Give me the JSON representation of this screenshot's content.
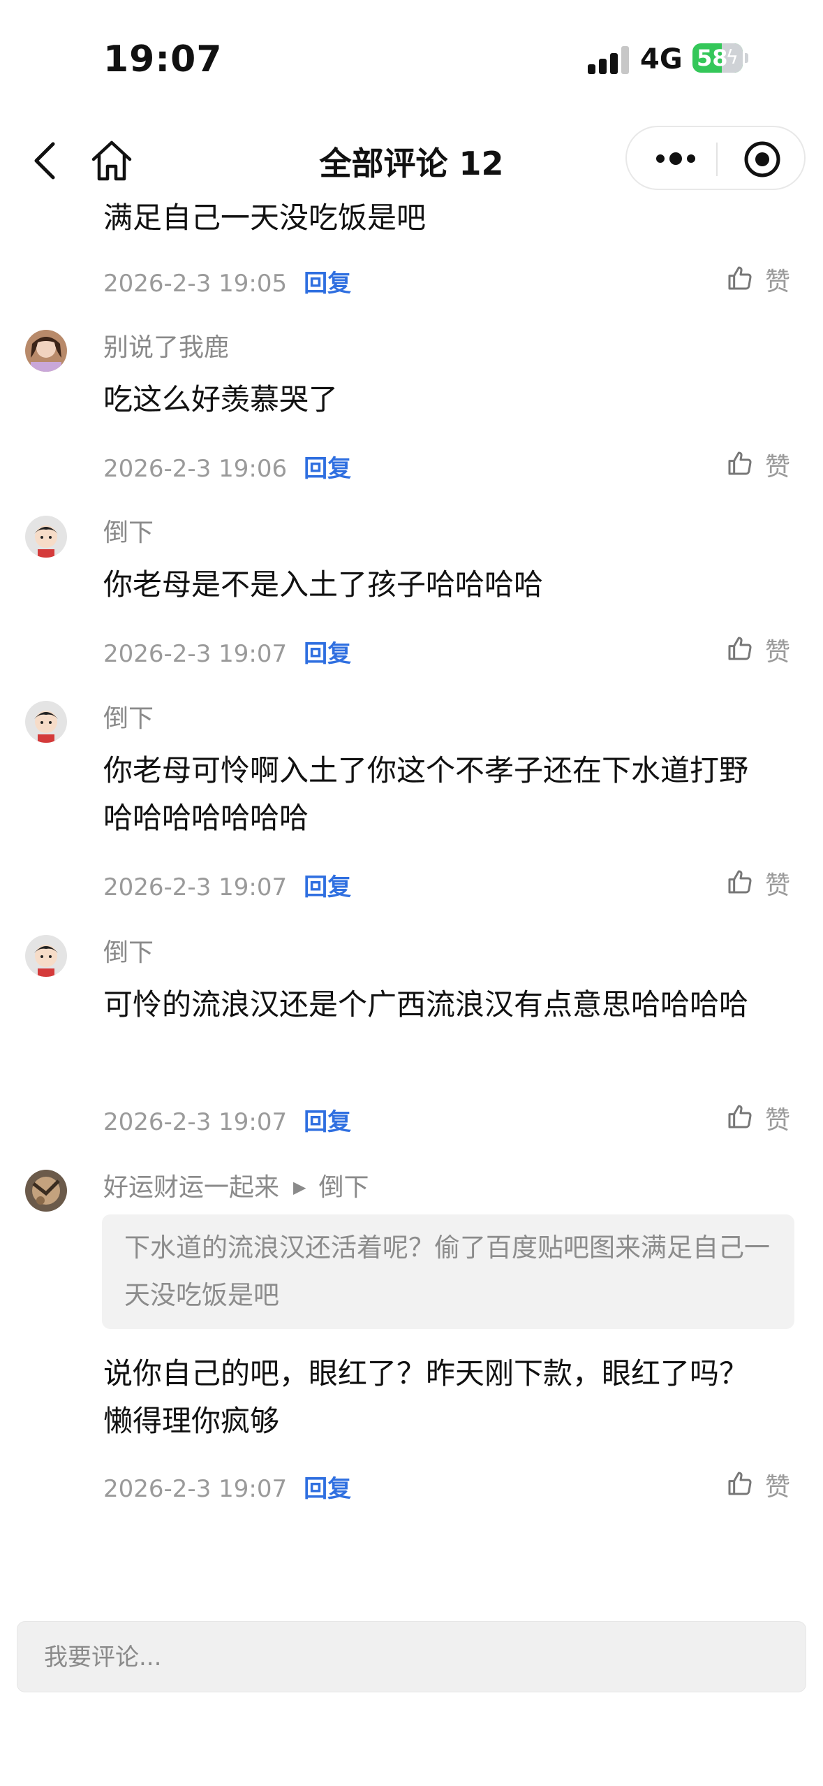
{
  "status_bar": {
    "time": "19:07",
    "network": "4G",
    "battery": "58"
  },
  "nav": {
    "title": "全部评论 12"
  },
  "comments": [
    {
      "author": "",
      "text": "满足自己一天没吃饭是吧",
      "time": "2026-2-3 19:05",
      "reply": "回复",
      "like": "赞"
    },
    {
      "author": "别说了我鹿",
      "text": "吃这么好羡慕哭了",
      "time": "2026-2-3 19:06",
      "reply": "回复",
      "like": "赞"
    },
    {
      "author": "倒下",
      "text": "你老母是不是入土了孩子哈哈哈哈",
      "time": "2026-2-3 19:07",
      "reply": "回复",
      "like": "赞"
    },
    {
      "author": "倒下",
      "text": "你老母可怜啊入土了你这个不孝子还在下水道打野哈哈哈哈哈哈哈",
      "time": "2026-2-3 19:07",
      "reply": "回复",
      "like": "赞"
    },
    {
      "author": "倒下",
      "text": "可怜的流浪汉还是个广西流浪汉有点意思哈哈哈哈",
      "time": "2026-2-3 19:07",
      "reply": "回复",
      "like": "赞"
    },
    {
      "author": "好运财运一起来",
      "reply_to": "倒下",
      "quote": "下水道的流浪汉还活着呢？偷了百度贴吧图来满足自己一天没吃饭是吧",
      "text": "说你自己的吧，眼红了？昨天刚下款，眼红了吗？懒得理你疯够",
      "time": "2026-2-3 19:07",
      "reply": "回复",
      "like": "赞"
    }
  ],
  "input": {
    "placeholder": "我要评论..."
  },
  "colors": {
    "reply_link": "#2f6fe0",
    "battery": "#34c759",
    "meta": "#9a9a9a"
  }
}
